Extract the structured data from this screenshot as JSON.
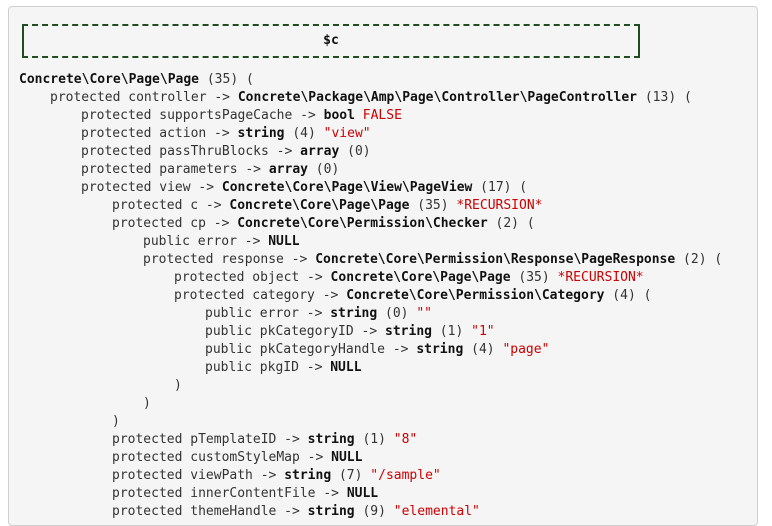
{
  "title": "$c",
  "lines": [
    {
      "indent": 0,
      "parts": [
        {
          "t": "b",
          "v": "Concrete\\Core\\Page\\Page"
        },
        {
          "t": "plain",
          "v": " (35) ("
        }
      ]
    },
    {
      "indent": 1,
      "parts": [
        {
          "t": "kw",
          "v": "protected controller -> "
        },
        {
          "t": "b",
          "v": "Concrete\\Package\\Amp\\Page\\Controller\\PageController"
        },
        {
          "t": "plain",
          "v": " (13) ("
        }
      ]
    },
    {
      "indent": 2,
      "parts": [
        {
          "t": "kw",
          "v": "protected supportsPageCache -> "
        },
        {
          "t": "b",
          "v": "bool"
        },
        {
          "t": "plain",
          "v": " "
        },
        {
          "t": "s",
          "v": "FALSE"
        }
      ]
    },
    {
      "indent": 2,
      "parts": [
        {
          "t": "kw",
          "v": "protected action -> "
        },
        {
          "t": "b",
          "v": "string"
        },
        {
          "t": "plain",
          "v": " (4) "
        },
        {
          "t": "s",
          "v": "\"view\""
        }
      ]
    },
    {
      "indent": 2,
      "parts": [
        {
          "t": "kw",
          "v": "protected passThruBlocks -> "
        },
        {
          "t": "b",
          "v": "array"
        },
        {
          "t": "plain",
          "v": " (0)"
        }
      ]
    },
    {
      "indent": 2,
      "parts": [
        {
          "t": "kw",
          "v": "protected parameters -> "
        },
        {
          "t": "b",
          "v": "array"
        },
        {
          "t": "plain",
          "v": " (0)"
        }
      ]
    },
    {
      "indent": 2,
      "parts": [
        {
          "t": "kw",
          "v": "protected view -> "
        },
        {
          "t": "b",
          "v": "Concrete\\Core\\Page\\View\\PageView"
        },
        {
          "t": "plain",
          "v": " (17) ("
        }
      ]
    },
    {
      "indent": 3,
      "parts": [
        {
          "t": "kw",
          "v": "protected c -> "
        },
        {
          "t": "b",
          "v": "Concrete\\Core\\Page\\Page"
        },
        {
          "t": "plain",
          "v": " (35) "
        },
        {
          "t": "s",
          "v": "*RECURSION*"
        }
      ]
    },
    {
      "indent": 3,
      "parts": [
        {
          "t": "kw",
          "v": "protected cp -> "
        },
        {
          "t": "b",
          "v": "Concrete\\Core\\Permission\\Checker"
        },
        {
          "t": "plain",
          "v": " (2) ("
        }
      ]
    },
    {
      "indent": 4,
      "parts": [
        {
          "t": "kw",
          "v": "public error -> "
        },
        {
          "t": "b",
          "v": "NULL"
        }
      ]
    },
    {
      "indent": 4,
      "parts": [
        {
          "t": "kw",
          "v": "protected response -> "
        },
        {
          "t": "b",
          "v": "Concrete\\Core\\Permission\\Response\\PageResponse"
        },
        {
          "t": "plain",
          "v": " (2) ("
        }
      ]
    },
    {
      "indent": 5,
      "parts": [
        {
          "t": "kw",
          "v": "protected object -> "
        },
        {
          "t": "b",
          "v": "Concrete\\Core\\Page\\Page"
        },
        {
          "t": "plain",
          "v": " (35) "
        },
        {
          "t": "s",
          "v": "*RECURSION*"
        }
      ]
    },
    {
      "indent": 5,
      "parts": [
        {
          "t": "kw",
          "v": "protected category -> "
        },
        {
          "t": "b",
          "v": "Concrete\\Core\\Permission\\Category"
        },
        {
          "t": "plain",
          "v": " (4) ("
        }
      ]
    },
    {
      "indent": 6,
      "parts": [
        {
          "t": "kw",
          "v": "public error -> "
        },
        {
          "t": "b",
          "v": "string"
        },
        {
          "t": "plain",
          "v": " (0) "
        },
        {
          "t": "s",
          "v": "\"\""
        }
      ]
    },
    {
      "indent": 6,
      "parts": [
        {
          "t": "kw",
          "v": "public pkCategoryID -> "
        },
        {
          "t": "b",
          "v": "string"
        },
        {
          "t": "plain",
          "v": " (1) "
        },
        {
          "t": "s",
          "v": "\"1\""
        }
      ]
    },
    {
      "indent": 6,
      "parts": [
        {
          "t": "kw",
          "v": "public pkCategoryHandle -> "
        },
        {
          "t": "b",
          "v": "string"
        },
        {
          "t": "plain",
          "v": " (4) "
        },
        {
          "t": "s",
          "v": "\"page\""
        }
      ]
    },
    {
      "indent": 6,
      "parts": [
        {
          "t": "kw",
          "v": "public pkgID -> "
        },
        {
          "t": "b",
          "v": "NULL"
        }
      ]
    },
    {
      "indent": 5,
      "parts": [
        {
          "t": "plain",
          "v": ")"
        }
      ]
    },
    {
      "indent": 4,
      "parts": [
        {
          "t": "plain",
          "v": ")"
        }
      ]
    },
    {
      "indent": 3,
      "parts": [
        {
          "t": "plain",
          "v": ")"
        }
      ]
    },
    {
      "indent": 3,
      "parts": [
        {
          "t": "kw",
          "v": "protected pTemplateID -> "
        },
        {
          "t": "b",
          "v": "string"
        },
        {
          "t": "plain",
          "v": " (1) "
        },
        {
          "t": "s",
          "v": "\"8\""
        }
      ]
    },
    {
      "indent": 3,
      "parts": [
        {
          "t": "kw",
          "v": "protected customStyleMap -> "
        },
        {
          "t": "b",
          "v": "NULL"
        }
      ]
    },
    {
      "indent": 3,
      "parts": [
        {
          "t": "kw",
          "v": "protected viewPath -> "
        },
        {
          "t": "b",
          "v": "string"
        },
        {
          "t": "plain",
          "v": " (7) "
        },
        {
          "t": "s",
          "v": "\"/sample\""
        }
      ]
    },
    {
      "indent": 3,
      "parts": [
        {
          "t": "kw",
          "v": "protected innerContentFile -> "
        },
        {
          "t": "b",
          "v": "NULL"
        }
      ]
    },
    {
      "indent": 3,
      "parts": [
        {
          "t": "kw",
          "v": "protected themeHandle -> "
        },
        {
          "t": "b",
          "v": "string"
        },
        {
          "t": "plain",
          "v": " (9) "
        },
        {
          "t": "s",
          "v": "\"elemental\""
        }
      ]
    }
  ],
  "colors": {
    "accent_string": "#cc0000",
    "box_border": "#1f4d1f",
    "panel_bg": "#f5f5f5"
  }
}
